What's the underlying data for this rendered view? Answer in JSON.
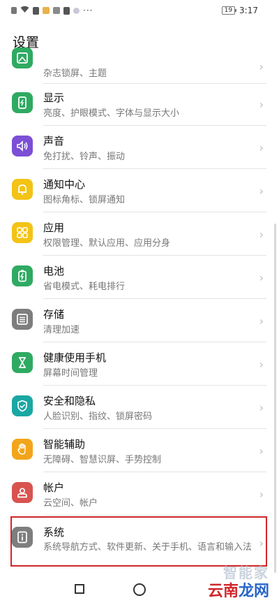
{
  "status_bar": {
    "time": "3:17",
    "battery": "19",
    "dots": "···"
  },
  "page_title": "设置",
  "items": [
    {
      "id": "themes",
      "sub": "杂志锁屏、主题",
      "color": "#2faa62",
      "icon": "image-icon"
    },
    {
      "id": "display",
      "title": "显示",
      "sub": "亮度、护眼模式、字体与显示大小",
      "color": "#2faa62",
      "icon": "phone-brightness-icon"
    },
    {
      "id": "sound",
      "title": "声音",
      "sub": "免打扰、铃声、振动",
      "color": "#7b4fd6",
      "icon": "speaker-icon"
    },
    {
      "id": "notifications",
      "title": "通知中心",
      "sub": "图标角标、锁屏通知",
      "color": "#f3c315",
      "icon": "bell-icon"
    },
    {
      "id": "apps",
      "title": "应用",
      "sub": "权限管理、默认应用、应用分身",
      "color": "#f3c315",
      "icon": "grid-icon"
    },
    {
      "id": "battery",
      "title": "电池",
      "sub": "省电模式、耗电排行",
      "color": "#2faa62",
      "icon": "battery-icon"
    },
    {
      "id": "storage",
      "title": "存储",
      "sub": "清理加速",
      "color": "#7e7e7e",
      "icon": "storage-icon"
    },
    {
      "id": "digital-balance",
      "title": "健康使用手机",
      "sub": "屏幕时间管理",
      "color": "#2faa62",
      "icon": "hourglass-icon"
    },
    {
      "id": "security",
      "title": "安全和隐私",
      "sub": "人脸识别、指纹、锁屏密码",
      "color": "#1aa7a3",
      "icon": "shield-icon"
    },
    {
      "id": "accessibility",
      "title": "智能辅助",
      "sub": "无障碍、智慧识屏、手势控制",
      "color": "#f2a51a",
      "icon": "hand-icon"
    },
    {
      "id": "accounts",
      "title": "帐户",
      "sub": "云空间、帐户",
      "color": "#d9534f",
      "icon": "user-icon"
    },
    {
      "id": "system",
      "title": "系统",
      "sub": "系统导航方式、软件更新、关于手机、语言和输入法",
      "color": "#7e7e7e",
      "icon": "info-icon"
    }
  ],
  "chevron": "›",
  "watermark": {
    "top": "智能家",
    "main_a": "云南",
    "main_b": "龙网"
  }
}
